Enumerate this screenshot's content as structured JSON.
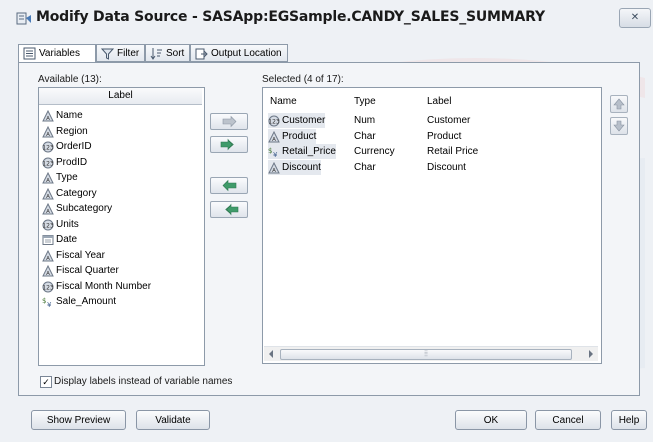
{
  "window": {
    "title": "Modify Data Source - SASApp:EGSample.CANDY_SALES_SUMMARY"
  },
  "tabs": [
    {
      "label": "Variables"
    },
    {
      "label": "Filter"
    },
    {
      "label": "Sort"
    },
    {
      "label": "Output Location"
    }
  ],
  "available": {
    "caption": "Available (13):",
    "column_header": "Label",
    "items": [
      {
        "label": "Name",
        "kind": "char"
      },
      {
        "label": "Region",
        "kind": "char"
      },
      {
        "label": "OrderID",
        "kind": "num"
      },
      {
        "label": "ProdID",
        "kind": "num"
      },
      {
        "label": "Type",
        "kind": "char"
      },
      {
        "label": "Category",
        "kind": "char"
      },
      {
        "label": "Subcategory",
        "kind": "char"
      },
      {
        "label": "Units",
        "kind": "num"
      },
      {
        "label": "Date",
        "kind": "date"
      },
      {
        "label": "Fiscal Year",
        "kind": "char"
      },
      {
        "label": "Fiscal Quarter",
        "kind": "char"
      },
      {
        "label": "Fiscal Month Number",
        "kind": "num"
      },
      {
        "label": "Sale_Amount",
        "kind": "currency"
      }
    ]
  },
  "selected": {
    "caption": "Selected (4 of 17):",
    "columns": [
      "Name",
      "Type",
      "Label"
    ],
    "rows": [
      {
        "name": "Customer",
        "type": "Num",
        "label": "Customer",
        "kind": "num"
      },
      {
        "name": "Product",
        "type": "Char",
        "label": "Product",
        "kind": "char"
      },
      {
        "name": "Retail_Price",
        "type": "Currency",
        "label": "Retail Price",
        "kind": "currency"
      },
      {
        "name": "Discount",
        "type": "Char",
        "label": "Discount",
        "kind": "char"
      }
    ]
  },
  "checkbox": {
    "label": "Display labels instead of variable names",
    "checked": true
  },
  "buttons": {
    "show_preview": "Show Preview",
    "validate": "Validate",
    "ok": "OK",
    "cancel": "Cancel",
    "help": "Help"
  },
  "colors": {
    "window_bg": "#eef1f5",
    "arrow_green": "#49a344",
    "arrow_blue": "#4a7bb7"
  }
}
